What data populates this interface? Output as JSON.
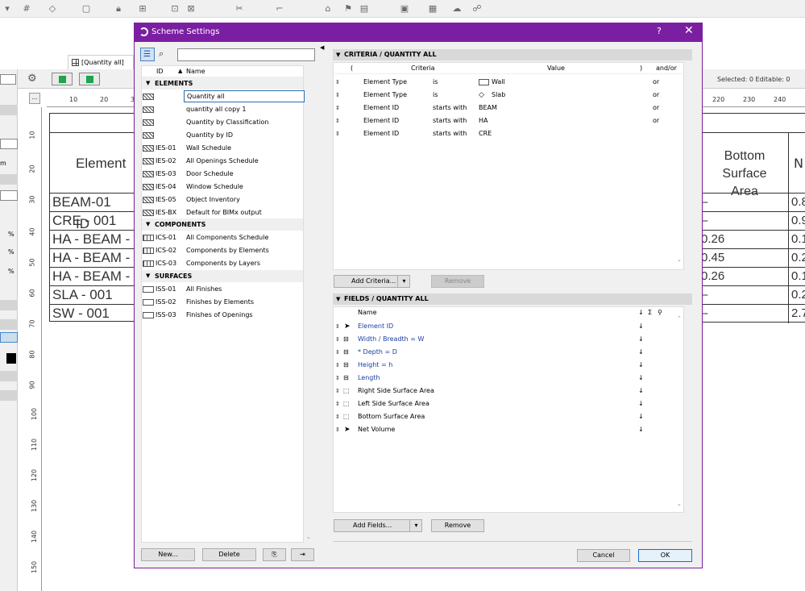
{
  "background": {
    "tab_label": "[Quantity all]",
    "selection_info": "Selected: 0  Editable: 0",
    "ruler_ticks": [
      "10",
      "20",
      "3",
      "220",
      "230",
      "240"
    ],
    "vruler_ticks": [
      "10",
      "20",
      "30",
      "40",
      "50",
      "60",
      "70",
      "80",
      "90",
      "100",
      "110",
      "120",
      "130",
      "140",
      "150"
    ],
    "schedule_left": {
      "header": "Element ID",
      "rows": [
        "BEAM-01",
        "CRE - 001",
        "HA - BEAM - 0",
        "HA - BEAM - 0",
        "HA - BEAM - 0",
        "SLA - 001",
        "SW - 001"
      ]
    },
    "schedule_right": {
      "header_line1": "Bottom Surface",
      "header_line2": "Area",
      "header_next": "N",
      "rows": [
        {
          "a": "–",
          "b": "0.8"
        },
        {
          "a": "–",
          "b": "0.9"
        },
        {
          "a": "0.26",
          "b": "0.1"
        },
        {
          "a": "0.45",
          "b": "0.2"
        },
        {
          "a": "0.26",
          "b": "0.1"
        },
        {
          "a": "–",
          "b": "0.2"
        },
        {
          "a": "–",
          "b": "2.7"
        }
      ]
    },
    "left_strip_labels": [
      "m",
      "%",
      "%",
      "%"
    ]
  },
  "dialog": {
    "title": "Scheme Settings",
    "help": "?",
    "close": "✕",
    "search": {
      "placeholder": ""
    },
    "list": {
      "col_id": "ID",
      "col_name": "Name",
      "groups": [
        {
          "label": "ELEMENTS",
          "items": [
            {
              "id": "",
              "name": "Quantity all"
            },
            {
              "id": "",
              "name": "quantity all copy 1"
            },
            {
              "id": "",
              "name": "Quantity by Classification"
            },
            {
              "id": "",
              "name": "Quantity by ID"
            },
            {
              "id": "IES-01",
              "name": "Wall Schedule"
            },
            {
              "id": "IES-02",
              "name": "All Openings Schedule"
            },
            {
              "id": "IES-03",
              "name": "Door Schedule"
            },
            {
              "id": "IES-04",
              "name": "Window Schedule"
            },
            {
              "id": "IES-05",
              "name": "Object Inventory"
            },
            {
              "id": "IES-BX",
              "name": "Default for BIMx output"
            }
          ]
        },
        {
          "label": "COMPONENTS",
          "items": [
            {
              "id": "ICS-01",
              "name": "All Components Schedule"
            },
            {
              "id": "ICS-02",
              "name": "Components by Elements"
            },
            {
              "id": "ICS-03",
              "name": "Components by Layers"
            }
          ]
        },
        {
          "label": "SURFACES",
          "items": [
            {
              "id": "ISS-01",
              "name": "All Finishes"
            },
            {
              "id": "ISS-02",
              "name": "Finishes by Elements"
            },
            {
              "id": "ISS-03",
              "name": "Finishes of Openings"
            }
          ]
        }
      ]
    },
    "buttons": {
      "new": "New...",
      "delete": "Delete",
      "cancel": "Cancel",
      "ok": "OK"
    },
    "criteria": {
      "header": "CRITERIA / QUANTITY ALL",
      "cols": {
        "open": "(",
        "criteria": "Criteria",
        "value": "Value",
        "close": ")",
        "andor": "and/or"
      },
      "rows": [
        {
          "criteria": "Element Type",
          "op": "is",
          "value": "Wall",
          "andor": "or"
        },
        {
          "criteria": "Element Type",
          "op": "is",
          "value": "Slab",
          "andor": "or"
        },
        {
          "criteria": "Element ID",
          "op": "starts with",
          "value": "BEAM",
          "andor": "or"
        },
        {
          "criteria": "Element ID",
          "op": "starts with",
          "value": "HA",
          "andor": "or"
        },
        {
          "criteria": "Element ID",
          "op": "starts with",
          "value": "CRE",
          "andor": ""
        }
      ],
      "add_label": "Add Criteria...",
      "remove_label": "Remove"
    },
    "fields": {
      "header": "FIELDS / QUANTITY ALL",
      "col_name": "Name",
      "col_sort": "↓",
      "col_sum": "Σ",
      "rows": [
        {
          "name": "Element ID",
          "sort": "↓"
        },
        {
          "name": "Width / Breadth = W",
          "sort": "↓"
        },
        {
          "name": "* Depth = D",
          "sort": "↓"
        },
        {
          "name": "Height = h",
          "sort": "↓"
        },
        {
          "name": "Length",
          "sort": "↓"
        },
        {
          "name": "Right Side Surface Area",
          "sort": "↓"
        },
        {
          "name": "Left Side Surface Area",
          "sort": "↓"
        },
        {
          "name": "Bottom Surface Area",
          "sort": "↓"
        },
        {
          "name": "Net Volume",
          "sort": "↓"
        }
      ],
      "add_label": "Add Fields...",
      "remove_label": "Remove"
    }
  }
}
